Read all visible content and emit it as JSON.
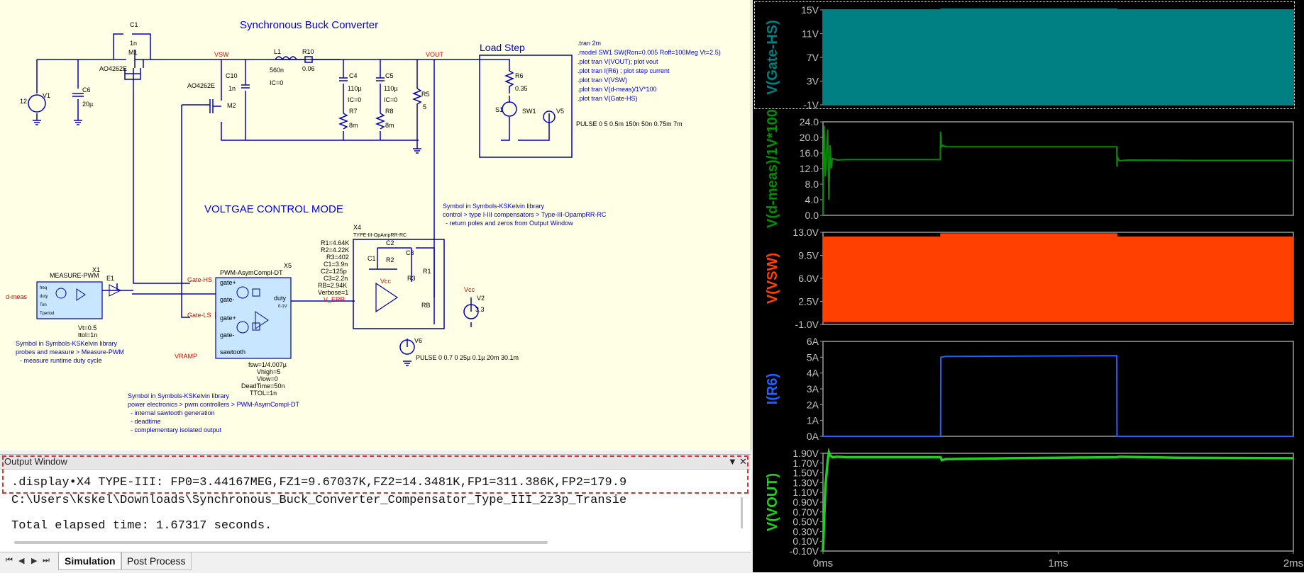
{
  "schematic": {
    "title": "Synchronous Buck Converter",
    "load_step_label": "Load Step",
    "mode_label": "VOLTGAE CONTROL MODE",
    "spice_directives": [
      ".tran 2m",
      ".model SW1 SW(Ron=0.005 Roff=100Meg Vt=2.5)",
      ".plot tran V(VOUT); plot vout",
      ".plot tran I(R6) ; plot step current",
      ".plot tran V(VSW)",
      ".plot tran V(d-meas)/1V*100",
      ".plot tran V(Gate-HS)"
    ],
    "pulse_v5": "PULSE 0 5 0.5m 150n 50n 0.75m 7m",
    "pulse_v6": "PULSE 0 0.7 0 25µ 0.1µ 20m 30.1m",
    "nets": {
      "vsw": "VSW",
      "vout": "VOUT",
      "gate_hs": "Gate-HS",
      "gate_ls": "Gate-LS",
      "vramp": "VRAMP",
      "d_meas": "d-meas",
      "v_err": "V_ERR",
      "vcc": "Vcc",
      "vcc2": "Vcc"
    },
    "components": {
      "c1": "C1",
      "c1_val": "1n",
      "m1": "M1",
      "m1_part": "AO4262E",
      "m2": "M2",
      "m2_part": "AO4262E",
      "v1": "V1",
      "v1_val": "12",
      "c6": "C6",
      "c6_val": "20µ",
      "c10": "C10",
      "c10_val": "1n",
      "l1": "L1",
      "l1_val": "560n",
      "l1_ic": "IC=0",
      "r10": "R10",
      "r10_val": "0.06",
      "c4": "C4",
      "c4_val": "110µ",
      "c4_ic": "IC=0",
      "c5": "C5",
      "c5_val": "110µ",
      "c5_ic": "IC=0",
      "r7": "R7",
      "r7_val": "8m",
      "r8": "R8",
      "r8_val": "8m",
      "r5": "R5",
      "r5_val": "5",
      "r6": "R6",
      "r6_val": "0.35",
      "s1": "S1",
      "sw1": "SW1",
      "v5": "V5",
      "x1": "X1",
      "x1_name": "MEASURE-PWM",
      "x1_pins": [
        "freq",
        "duty",
        "Ton",
        "Tperiod"
      ],
      "x1_params": [
        "Vt=0.5",
        "ttol=1n"
      ],
      "e1": "E1",
      "x5": "X5",
      "x5_name": "PWM-AsymCompl-DT",
      "x5_pins": [
        "gate+",
        "gate-",
        "gate+",
        "gate-",
        "sawtooth",
        "duty",
        "0-1V"
      ],
      "x5_params": [
        "fsw=1/4.007µ",
        "Vhigh=5",
        "Vlow=0",
        "DeadTime=50n",
        "TTOL=1n"
      ],
      "x4": "X4",
      "x4_name": "TYPE-III-OpAmpRR-RC",
      "x4_params": [
        "R1=4.64K",
        "R2=4.22K",
        "R3=402",
        "C1=3.9n",
        "C2=125p",
        "C3=2.2n",
        "RB=2.94K",
        "Verbose=1"
      ],
      "x4_inner": [
        "C2",
        "C1",
        "R2",
        "C3",
        "R3",
        "R1",
        "RB"
      ],
      "v2": "V2",
      "v2_val": "3.3",
      "v6": "V6"
    },
    "notes": {
      "measure": [
        "Symbol in Symbols-KSKelvin library",
        "probes and measure > Measure-PWM",
        "- measure runtime duty cycle"
      ],
      "pwm": [
        "Symbol in Symbols-KSKelvin library",
        "power electronics > pwm controllers > PWM-AsymCompl-DT",
        "- internal sawtooth generation",
        "- deadtime",
        "- complementary isolated output"
      ],
      "comp": [
        "Symbol in Symbols-KSKelvin library",
        "control > type I-III compensators > Type-III-OpampRR-RC",
        "- return poles and zeros from Output Window"
      ]
    }
  },
  "output_window": {
    "title": "Output Window",
    "lines": [
      ".display•X4 TYPE-III: FP0=3.44167MEG,FZ1=9.67037K,FZ2=14.3481K,FP1=311.386K,FP2=179.9",
      "C:\\Users\\kskel\\Downloads\\Synchronous_Buck_Converter_Compensator_Type_III_2z3p_Transie",
      "",
      "Total elapsed time: 1.67317 seconds."
    ]
  },
  "tabs": {
    "nav": [
      "⏮",
      "◀",
      "▶",
      "⏭"
    ],
    "items": [
      "Simulation",
      "Post Process"
    ],
    "active": 0
  },
  "colors": {
    "schematic_bg": "#ffffe6",
    "wire": "#0000c0",
    "net_label": "#e00000",
    "note": "#0000cc",
    "gate_hs": "#008080",
    "d_meas": "#009000",
    "vsw": "#ff4000",
    "i_r6": "#2060ff",
    "vout": "#20d020"
  },
  "chart_data": [
    {
      "type": "area",
      "name": "V(Gate-HS)",
      "ylabel": "V(Gate-HS)",
      "yticks": [
        "15V",
        "11V",
        "7V",
        "3V",
        "-1V"
      ],
      "ylim": [
        -1,
        17
      ],
      "x": [
        0,
        0.5,
        0.5,
        1.25,
        1.25,
        2
      ],
      "upper": [
        17,
        17,
        17.2,
        17.2,
        17,
        17
      ],
      "lower": [
        -1,
        -1,
        -1,
        -1,
        -1,
        -1
      ]
    },
    {
      "type": "line",
      "name": "V(d-meas)/1V*100",
      "ylabel": "V(d-meas)/1V*100",
      "yticks": [
        "24.0",
        "20.0",
        "16.0",
        "12.0",
        "8.0",
        "4.0",
        "0.0"
      ],
      "ylim": [
        0,
        24
      ],
      "x": [
        0,
        0.005,
        0.01,
        0.02,
        0.025,
        0.03,
        0.035,
        0.04,
        0.06,
        0.1,
        0.3,
        0.499,
        0.5,
        0.503,
        0.51,
        0.52,
        0.7,
        1.0,
        1.249,
        1.25,
        1.252,
        1.26,
        1.3,
        1.6,
        2.0
      ],
      "y": [
        0,
        23,
        10,
        22,
        4,
        18,
        12,
        14.6,
        14.2,
        14.3,
        14.3,
        14.3,
        21.5,
        17.5,
        18,
        17.6,
        17.6,
        17.6,
        17.6,
        12.5,
        15,
        14,
        14.2,
        14.1,
        14.1
      ]
    },
    {
      "type": "area",
      "name": "V(VSW)",
      "ylabel": "V(VSW)",
      "yticks": [
        "13.0V",
        "9.5V",
        "6.0V",
        "2.5V",
        "-1.0V"
      ],
      "ylim": [
        -1,
        13
      ],
      "x": [
        0,
        0.5,
        0.5,
        1.25,
        1.25,
        2
      ],
      "upper": [
        12.3,
        12.3,
        12.8,
        12.8,
        12.3,
        12.3
      ],
      "lower": [
        -0.6,
        -0.6,
        -0.6,
        -0.6,
        -0.6,
        -0.6
      ]
    },
    {
      "type": "line",
      "name": "I(R6)",
      "ylabel": "I(R6)",
      "yticks": [
        "6A",
        "5A",
        "4A",
        "3A",
        "2A",
        "1A",
        "0A"
      ],
      "ylim": [
        0,
        6
      ],
      "x": [
        0,
        0.5,
        0.501,
        0.52,
        1.0,
        1.249,
        1.25,
        2.0
      ],
      "y": [
        0,
        0,
        5.0,
        5.05,
        5.08,
        5.1,
        0,
        0
      ]
    },
    {
      "type": "line",
      "name": "V(VOUT)",
      "ylabel": "V(VOUT)",
      "yticks": [
        "1.90V",
        "1.70V",
        "1.50V",
        "1.30V",
        "1.10V",
        "0.90V",
        "0.70V",
        "0.50V",
        "0.30V",
        "0.10V",
        "-0.10V"
      ],
      "ylim": [
        -0.1,
        1.9
      ],
      "x": [
        0,
        0.01,
        0.02,
        0.025,
        0.03,
        0.04,
        0.06,
        0.1,
        0.3,
        0.5,
        0.505,
        0.52,
        0.8,
        1.0,
        1.25,
        1.26,
        1.5,
        2.0
      ],
      "y": [
        -0.1,
        1.2,
        1.75,
        1.92,
        1.86,
        1.82,
        1.83,
        1.82,
        1.82,
        1.82,
        1.76,
        1.78,
        1.8,
        1.81,
        1.82,
        1.83,
        1.81,
        1.8
      ],
      "xticks": [
        "0ms",
        "1ms",
        "2ms"
      ],
      "xlim": [
        0,
        2
      ]
    }
  ]
}
